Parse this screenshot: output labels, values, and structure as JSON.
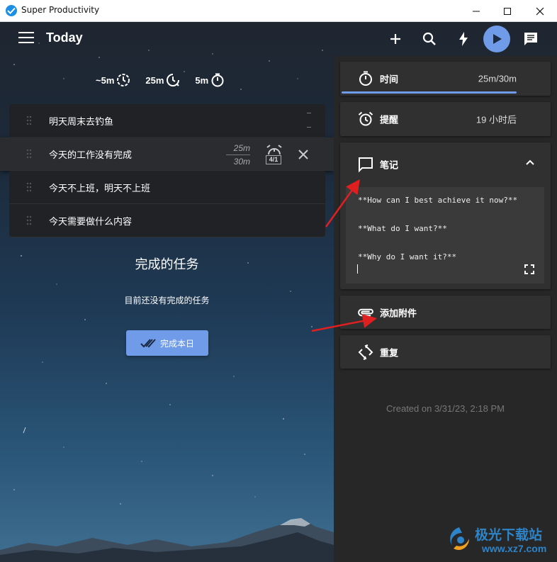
{
  "window": {
    "title": "Super Productivity"
  },
  "header": {
    "title": "Today"
  },
  "estimates": [
    {
      "value": "~5m",
      "icon": "clock-history-icon"
    },
    {
      "value": "25m",
      "icon": "clock-progress-icon"
    },
    {
      "value": "5m",
      "icon": "timer-icon"
    }
  ],
  "tasks": [
    {
      "label": "明天周末去钓鱼"
    },
    {
      "label": "今天的工作没有完成",
      "time_spent": "25m",
      "time_estimate": "30m",
      "reminder_count": "4/1"
    },
    {
      "label": "今天不上班，明天不上班"
    },
    {
      "label": "今天需要做什么内容"
    }
  ],
  "done": {
    "title": "完成的任务",
    "empty_text": "目前还没有完成的任务",
    "finish_button": "完成本日"
  },
  "panel": {
    "time": {
      "label": "时间",
      "value": "25m/30m",
      "progress": 0.83
    },
    "reminder": {
      "label": "提醒",
      "value": "19 小时后"
    },
    "notes": {
      "label": "笔记",
      "lines": [
        "**How can I best achieve it now?**",
        "**What do I want?**",
        "**Why do I want it?**"
      ]
    },
    "attachment": {
      "label": "添加附件"
    },
    "repeat": {
      "label": "重复"
    },
    "created": "Created on 3/31/23, 2:18 PM"
  },
  "watermark": {
    "title": "极光下载站",
    "url": "www.xz7.com"
  },
  "colors": {
    "accent": "#6f9be8",
    "panel": "#272727",
    "card": "#303030",
    "task": "#202225",
    "annotation": "#e02020"
  }
}
